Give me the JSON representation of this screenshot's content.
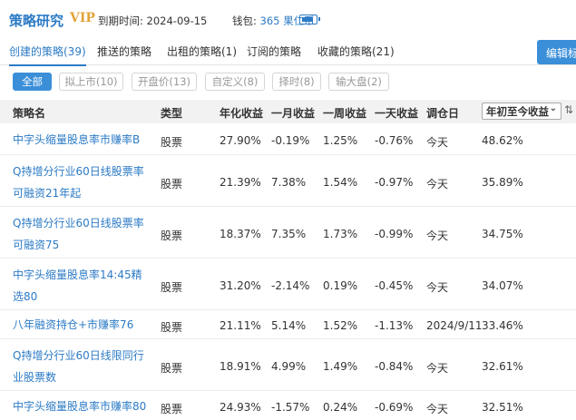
{
  "header": {
    "app_title": "策略研究",
    "vip": "VIP",
    "expire_label": "到期时间: 2024-09-15",
    "wallet_label": "钱包: ",
    "wallet_amount": "365 果仁币",
    "accent_color": "#2c7bc6"
  },
  "tabs": [
    {
      "label": "创建的策略(39)",
      "active": true
    },
    {
      "label": "推送的策略"
    },
    {
      "label": "出租的策略(1)"
    },
    {
      "label": "订阅的策略"
    },
    {
      "label": "收藏的策略(21)"
    }
  ],
  "edit_button": "编辑标",
  "filters": [
    {
      "label": "全部",
      "active": true
    },
    {
      "label": "拟上市(10)"
    },
    {
      "label": "开盘价(13)"
    },
    {
      "label": "自定义(8)"
    },
    {
      "label": "择时(8)"
    },
    {
      "label": "输大盘(2)"
    }
  ],
  "columns": {
    "name": "策略名",
    "type": "类型",
    "annual": "年化收益",
    "month": "一月收益",
    "week": "一周收益",
    "day": "一天收益",
    "rebalance": "调仓日",
    "sort_select": "年初至今收益"
  },
  "rows": [
    {
      "name": "中字头缩量股息率市赚率B",
      "type": "股票",
      "annual": "27.90%",
      "month": "-0.19%",
      "week": "1.25%",
      "day": "-0.76%",
      "rebalance": "今天",
      "ytd": "48.62%"
    },
    {
      "name": "Q持增分行业60日线股票率可融资21年起",
      "type": "股票",
      "annual": "21.39%",
      "month": "7.38%",
      "week": "1.54%",
      "day": "-0.97%",
      "rebalance": "今天",
      "ytd": "35.89%"
    },
    {
      "name": "Q持增分行业60日线股票率可融资75",
      "type": "股票",
      "annual": "18.37%",
      "month": "7.35%",
      "week": "1.73%",
      "day": "-0.99%",
      "rebalance": "今天",
      "ytd": "34.75%"
    },
    {
      "name": "中字头缩量股息率14:45精选80",
      "type": "股票",
      "annual": "31.20%",
      "month": "-2.14%",
      "week": "0.19%",
      "day": "-0.45%",
      "rebalance": "今天",
      "ytd": "34.07%"
    },
    {
      "name": "八年融资持仓+市赚率76",
      "type": "股票",
      "annual": "21.11%",
      "month": "5.14%",
      "week": "1.52%",
      "day": "-1.13%",
      "rebalance": "2024/9/11",
      "ytd": "33.46%"
    },
    {
      "name": "Q持增分行业60日线限同行业股票数",
      "type": "股票",
      "annual": "18.91%",
      "month": "4.99%",
      "week": "1.49%",
      "day": "-0.84%",
      "rebalance": "今天",
      "ytd": "32.61%"
    },
    {
      "name": "中字头缩量股息率市赚率80",
      "type": "股票",
      "annual": "24.93%",
      "month": "-1.57%",
      "week": "0.24%",
      "day": "-0.69%",
      "rebalance": "今天",
      "ytd": "32.51%"
    }
  ]
}
